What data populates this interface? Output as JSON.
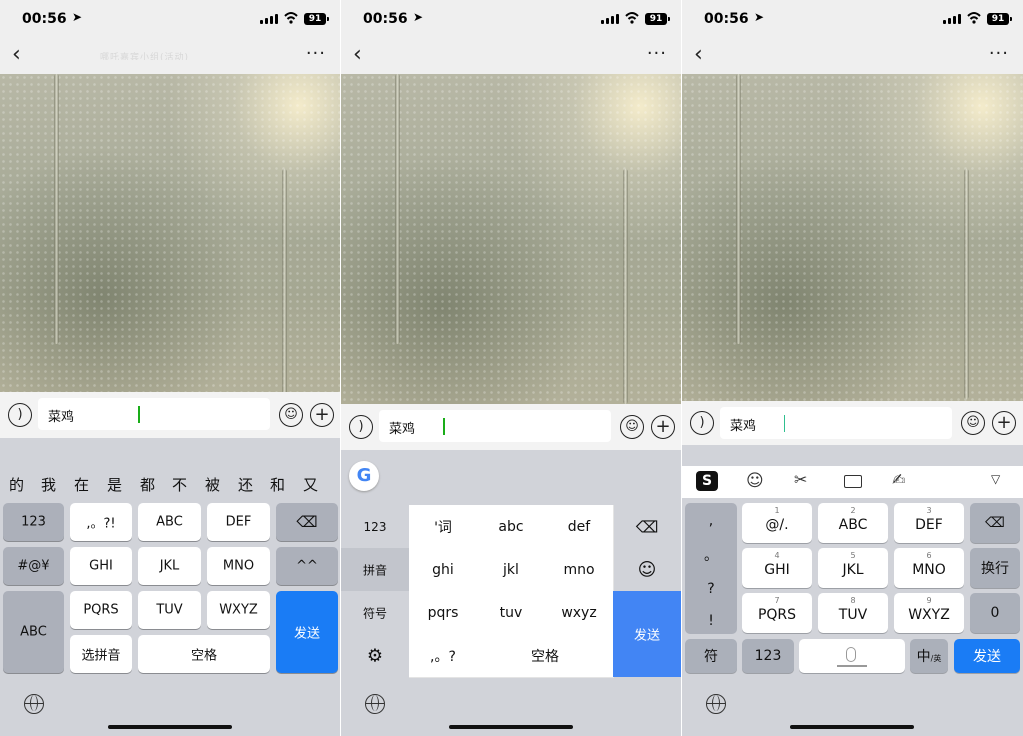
{
  "status": {
    "time": "00:56",
    "battery": "91",
    "location_arrow": "➤"
  },
  "nav": {
    "back": "‹",
    "more": "···",
    "chat_title": "哪吒嘉宾小组(活动)"
  },
  "input_text": "菜鸡",
  "icons": {
    "voice": "voice-icon",
    "emoji": "emoji-icon",
    "plus": "plus-icon",
    "globe": "globe-icon",
    "backspace": "backspace-icon",
    "settings": "gear-icon"
  },
  "panel1": {
    "candidates": [
      "的",
      "我",
      "在",
      "是",
      "都",
      "不",
      "被",
      "还",
      "和",
      "又"
    ],
    "keys": {
      "num": "123",
      "punct": ",。?!",
      "abc": "ABC",
      "def": "DEF",
      "back": "⌫",
      "sym": "#@¥",
      "ghi": "GHI",
      "jkl": "JKL",
      "mno": "MNO",
      "face": "^^",
      "abc_mode": "ABC",
      "pqrs": "PQRS",
      "tuv": "TUV",
      "wxyz": "WXYZ",
      "send": "发送",
      "select": "选拼音",
      "space": "空格"
    }
  },
  "panel2": {
    "google": "G",
    "side": [
      "123",
      "拼音",
      "符号"
    ],
    "keys": [
      "'词",
      "abc",
      "def",
      "ghi",
      "jkl",
      "mno",
      "pqrs",
      "tuv",
      "wxyz",
      ",。?",
      "空格"
    ],
    "send": "发送",
    "emoji": "☺",
    "back": "⌫",
    "settings": "⚙"
  },
  "panel3": {
    "toolbar": [
      "sogou-logo",
      "emoji-icon",
      "scissors-icon",
      "keyboard-icon",
      "handwrite-icon",
      "collapse-icon"
    ],
    "left": [
      ",",
      "。",
      "?",
      "!"
    ],
    "keys": [
      {
        "num": "1",
        "lbl": "@/."
      },
      {
        "num": "2",
        "lbl": "ABC"
      },
      {
        "num": "3",
        "lbl": "DEF"
      },
      {
        "num": "4",
        "lbl": "GHI"
      },
      {
        "num": "5",
        "lbl": "JKL"
      },
      {
        "num": "6",
        "lbl": "MNO"
      },
      {
        "num": "7",
        "lbl": "PQRS"
      },
      {
        "num": "8",
        "lbl": "TUV"
      },
      {
        "num": "9",
        "lbl": "WXYZ"
      }
    ],
    "right": {
      "back": "⌫",
      "enter": "换行",
      "zero": "0",
      "send": "发送"
    },
    "bottom": {
      "fu": "符",
      "num": "123",
      "lang": "中",
      "lang_sub": "/英"
    }
  }
}
